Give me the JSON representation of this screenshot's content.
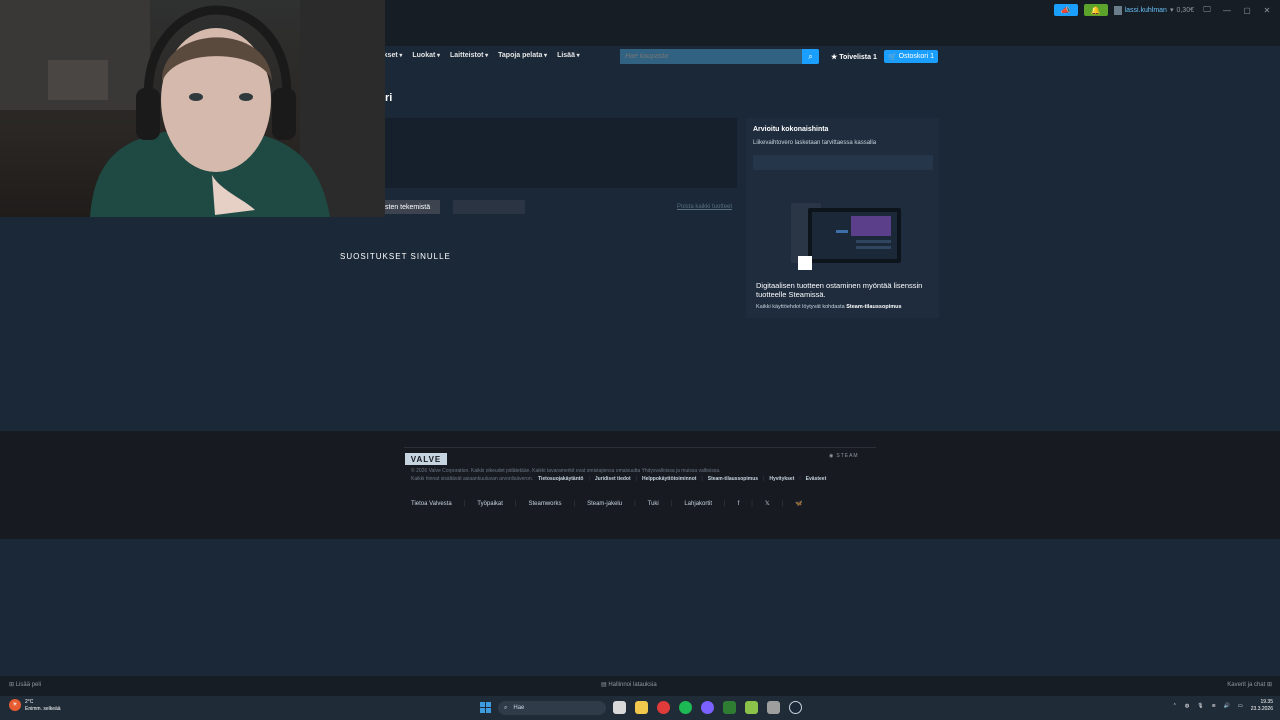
{
  "titlebar": {
    "username": "lassi.kuhlman",
    "balance": "0,30€",
    "window_controls": [
      "—",
      "▢",
      "✕"
    ]
  },
  "nav": {
    "menus": [
      "Suositukset",
      "Luokat",
      "Laitteistot",
      "Tapoja pelata",
      "Lisää"
    ],
    "search_placeholder": "Hae kaupasta",
    "wishlist_label": "Toivelista",
    "wishlist_count": "1",
    "cart_label": "Ostoskori",
    "cart_count": "1"
  },
  "page": {
    "title": "ri",
    "continue_label": "sten tekemistä",
    "remove_all": "Poista kaikki tuotteet"
  },
  "summary": {
    "title": "Arvioitu kokonaishinta",
    "subtitle": "Liikevaihtovero lasketaan tarvittaessa kassalla",
    "license_text": "Digitaalisen tuotteen ostaminen myöntää lisenssin tuotteelle Steamissä.",
    "terms_prefix": "Kaikki käyttöehdot löytyvät kohdasta",
    "terms_link": "Steam-tilaussopimus"
  },
  "recommendations": {
    "heading": "SUOSITUKSET SINULLE"
  },
  "footer": {
    "valve": "VALVE",
    "steam": "STEAM",
    "copyright": "© 2026 Valve Corporation. Kaikki oikeudet pidätetään. Kaikki tavaramerkit ovat omistajiensa omaisuutta Yhdysvalloissa ja muissa valtioissa.",
    "vat_note": "Kaikki hinnat sisältävät asiaankuuluvan arvonlisäveron.",
    "legal_links": [
      "Tietosuojakäytäntö",
      "Juridiset tiedot",
      "Helppokäyttötoiminnot",
      "Steam-tilaussopimus",
      "Hyvitykset",
      "Evästeet"
    ],
    "links": [
      "Tietoa Valvesta",
      "Työpaikat",
      "Steamworks",
      "Steam-jakelu",
      "Tuki",
      "Lahjakortit"
    ],
    "social": [
      "f",
      "𝕏",
      "🦋"
    ]
  },
  "steambar": {
    "add_game": "Lisää peli",
    "downloads": "Hallinnoi latauksia",
    "friends": "Kaverit ja chat"
  },
  "taskbar": {
    "temp": "2°C",
    "weather": "Enimm. selkeää",
    "search_placeholder": "Hae",
    "time": "19.35",
    "date": "23.3.2026"
  }
}
